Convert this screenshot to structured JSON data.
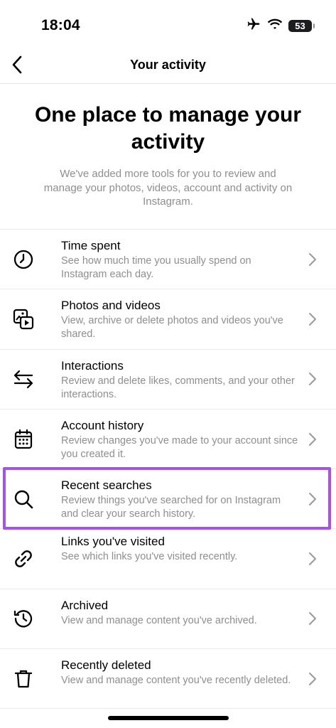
{
  "status_bar": {
    "time": "18:04",
    "battery": "53",
    "icons": [
      "airplane-icon",
      "wifi-icon",
      "battery-icon"
    ]
  },
  "nav": {
    "title": "Your activity",
    "back_icon": "chevron-left-icon"
  },
  "hero": {
    "title": "One place to manage your activity",
    "subtitle": "We've added more tools for you to review and manage your photos, videos, account and activity on Instagram."
  },
  "items": [
    {
      "icon": "clock-icon",
      "title": "Time spent",
      "description": "See how much time you usually spend on Instagram each day."
    },
    {
      "icon": "photos-videos-icon",
      "title": "Photos and videos",
      "description": "View, archive or delete photos and videos you've shared."
    },
    {
      "icon": "arrows-exchange-icon",
      "title": "Interactions",
      "description": "Review and delete likes, comments, and your other interactions."
    },
    {
      "icon": "calendar-icon",
      "title": "Account history",
      "description": "Review changes you've made to your account since you created it."
    },
    {
      "icon": "search-icon",
      "title": "Recent searches",
      "description": "Review things you've searched for on Instagram and clear your search history."
    },
    {
      "icon": "link-icon",
      "title": "Links you've visited",
      "description": "See which links you've visited recently."
    },
    {
      "icon": "history-icon",
      "title": "Archived",
      "description": "View and manage content you've archived."
    },
    {
      "icon": "trash-icon",
      "title": "Recently deleted",
      "description": "View and manage content you've recently deleted."
    }
  ],
  "highlight": {
    "item": "Recent searches",
    "color": "#a652e8"
  }
}
